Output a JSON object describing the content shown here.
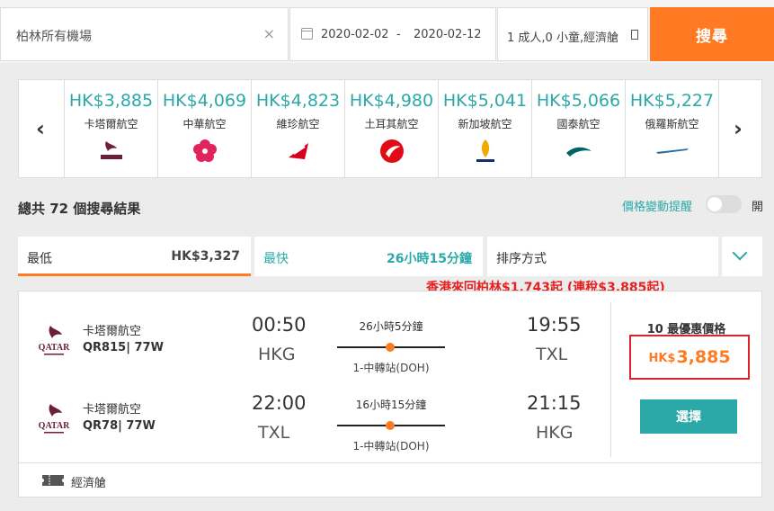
{
  "search": {
    "destination": "柏林所有機場",
    "clear_icon": "×",
    "depart_date": "2020-02-02",
    "date_separator": "-",
    "return_date": "2020-02-12",
    "passengers": "1 成人,0 小童,經濟艙",
    "search_label": "搜尋"
  },
  "carousel": {
    "prev_icon": "‹",
    "next_icon": "›",
    "airlines": [
      {
        "price": "HK$3,885",
        "name": "卡塔爾航空",
        "logo": "qatar"
      },
      {
        "price": "HK$4,069",
        "name": "中華航空",
        "logo": "china-airlines"
      },
      {
        "price": "HK$4,823",
        "name": "維珍航空",
        "logo": "virgin"
      },
      {
        "price": "HK$4,980",
        "name": "土耳其航空",
        "logo": "turkish"
      },
      {
        "price": "HK$5,041",
        "name": "新加坡航空",
        "logo": "singapore"
      },
      {
        "price": "HK$5,066",
        "name": "國泰航空",
        "logo": "cathay"
      },
      {
        "price": "HK$5,227",
        "name": "俄羅斯航空",
        "logo": "aeroflot"
      }
    ]
  },
  "results": {
    "count_text": "總共 72 個搜尋結果",
    "price_alert": "價格變動提醒",
    "toggle_label": "開"
  },
  "tabs": {
    "lowest_label": "最低",
    "lowest_value": "HK$3,327",
    "fastest_label": "最快",
    "fastest_value": "26小時15分鐘",
    "sort_label": "排序方式"
  },
  "promo": "香港來回柏林$1,743起 (連稅$3,885起)",
  "flight": {
    "legs": [
      {
        "airline": "卡塔爾航空",
        "flight": "QR815| 77W",
        "dep_time": "00:50",
        "dep_code": "HKG",
        "duration": "26小時5分鐘",
        "stops": "1-中轉站(DOH)",
        "arr_time": "19:55",
        "arr_code": "TXL"
      },
      {
        "airline": "卡塔爾航空",
        "flight": "QR78| 77W",
        "dep_time": "22:00",
        "dep_code": "TXL",
        "duration": "16小時15分鐘",
        "stops": "1-中轉站(DOH)",
        "arr_time": "21:15",
        "arr_code": "HKG"
      }
    ],
    "best_price_label": "10 最優惠價格",
    "price_currency": "HK$",
    "price_amount": "3,885",
    "select_label": "選擇",
    "cabin": "經濟艙"
  },
  "colors": {
    "accent_orange": "#ff7a22",
    "accent_teal": "#2aa9a8",
    "promo_red": "#e62121",
    "highlight_red": "#d9232d"
  }
}
